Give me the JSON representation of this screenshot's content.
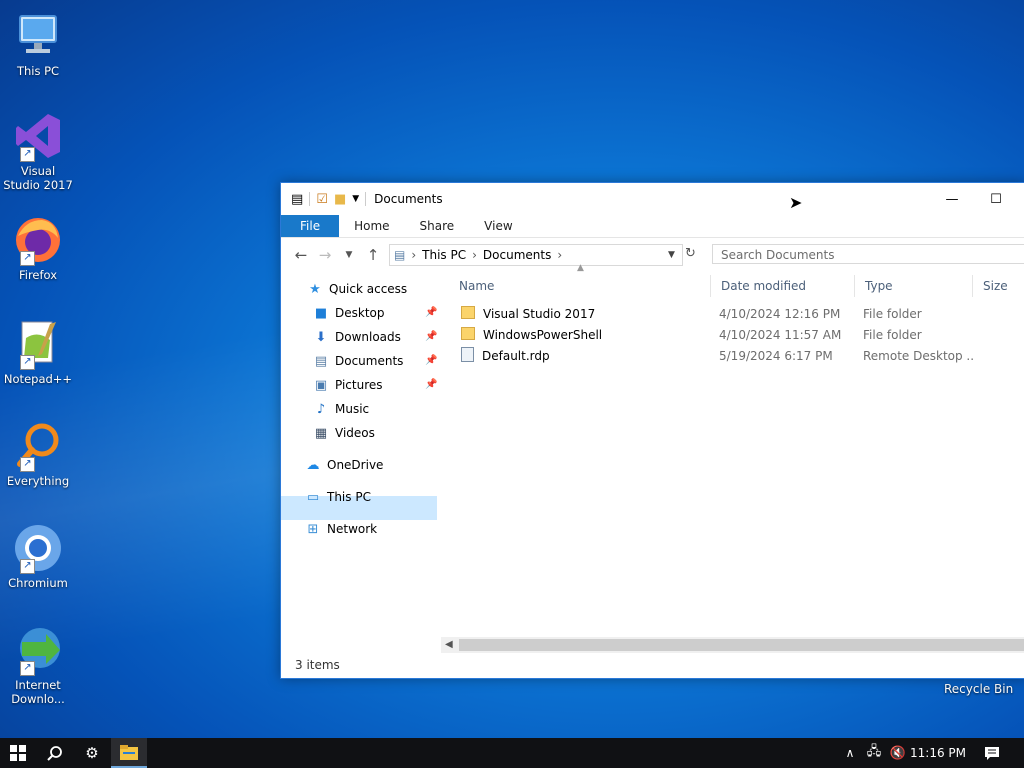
{
  "desktop": {
    "icons": [
      {
        "label": "This PC"
      },
      {
        "label": "Visual Studio 2017"
      },
      {
        "label": "Firefox"
      },
      {
        "label": "Notepad++"
      },
      {
        "label": "Everything"
      },
      {
        "label": "Chromium"
      },
      {
        "label": "Internet Downlo..."
      }
    ],
    "recycle_bin": "Recycle Bin"
  },
  "window": {
    "title": "Documents",
    "ribbon_tabs": [
      "File",
      "Home",
      "Share",
      "View"
    ],
    "breadcrumb": [
      "This PC",
      "Documents"
    ],
    "search_placeholder": "Search Documents",
    "nav": {
      "quick_access": "Quick access",
      "items": [
        "Desktop",
        "Downloads",
        "Documents",
        "Pictures",
        "Music",
        "Videos"
      ],
      "onedrive": "OneDrive",
      "this_pc": "This PC",
      "network": "Network"
    },
    "columns": [
      "Name",
      "Date modified",
      "Type",
      "Size"
    ],
    "files": [
      {
        "name": "Visual Studio 2017",
        "date": "4/10/2024 12:16 PM",
        "type": "File folder",
        "kind": "folder"
      },
      {
        "name": "WindowsPowerShell",
        "date": "4/10/2024 11:57 AM",
        "type": "File folder",
        "kind": "folder"
      },
      {
        "name": "Default.rdp",
        "date": "5/19/2024 6:17 PM",
        "type": "Remote Desktop ...",
        "kind": "rdp"
      }
    ],
    "status": "3 items"
  },
  "taskbar": {
    "time": "11:16 PM"
  },
  "colors": {
    "accent": "#1979ca",
    "selection": "#cce8ff",
    "taskbar": "#101114"
  }
}
